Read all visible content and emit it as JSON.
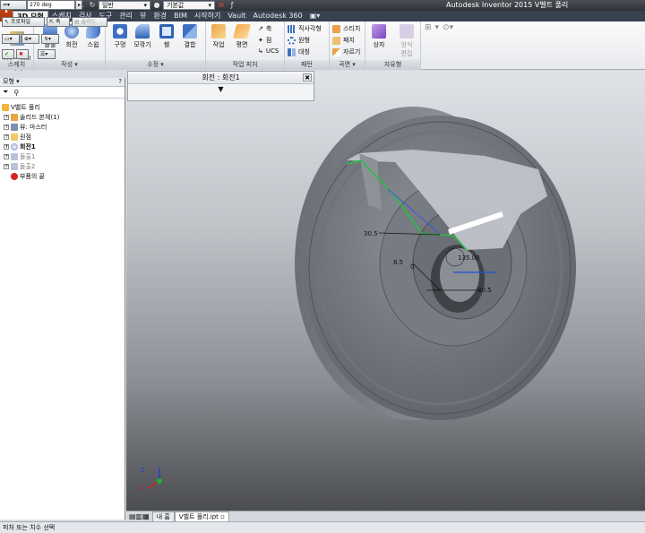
{
  "app": {
    "title": "Autodesk Inventor 2015    V벨트 풀리",
    "logo_letter": "I"
  },
  "qat": {
    "material": "일반",
    "appearance": "기본값"
  },
  "tabs": [
    "3D 모형",
    "스케치",
    "검사",
    "도구",
    "관리",
    "뷰",
    "환경",
    "BIM",
    "시작하기",
    "Vault",
    "Autodesk 360"
  ],
  "ribbon": {
    "sketch_panel": {
      "button": "2D 스케치\n시작",
      "label": "스케치"
    },
    "create_panel": {
      "buttons": [
        "돌출",
        "회전",
        "스윕"
      ],
      "label": "작성"
    },
    "modify_panel": {
      "buttons": [
        "구멍",
        "모깎기",
        "쉘",
        "결합"
      ],
      "label": "수정"
    },
    "work_panel": {
      "buttons": [
        "작업",
        "평면"
      ],
      "small": [
        "축",
        "점",
        "UCS"
      ],
      "label": "작업 피처"
    },
    "pattern_panel": {
      "small": [
        "직사각형",
        "원형",
        "대칭"
      ],
      "label": "패턴"
    },
    "surface_panel": {
      "small": [
        "스티치",
        "패치",
        "자르기"
      ],
      "label": "곡면"
    },
    "freeform_panel": {
      "buttons": [
        "상자",
        "양식\n편집"
      ],
      "label": "자유형"
    }
  },
  "dialog": {
    "title": "회전 : 회전1"
  },
  "browser": {
    "header": "모형",
    "items": [
      "V벨트 풀리",
      "솔리드 본체(1)",
      "뷰: 마스터",
      "원점",
      "회전1",
      "돌출1",
      "돌출2",
      "부품의 끝"
    ]
  },
  "minitoolbar": {
    "angle": "270 deg",
    "profile_btn": "프로파일",
    "axis_btn": "축",
    "solid_btn": "솔리드"
  },
  "dimensions": [
    "30.5",
    "8.5",
    "0",
    "135.00",
    "30.5"
  ],
  "doctabs": [
    "내 홈",
    "V벨트 풀리.ipt"
  ],
  "status": "피처 또는 치수 선택",
  "colors": {
    "accent": "#d94f16",
    "titlebar": "#2f3237",
    "tab_bg": "#38414d",
    "viewport_top": "#dfe2e7",
    "viewport_bottom": "#4a4c50"
  }
}
